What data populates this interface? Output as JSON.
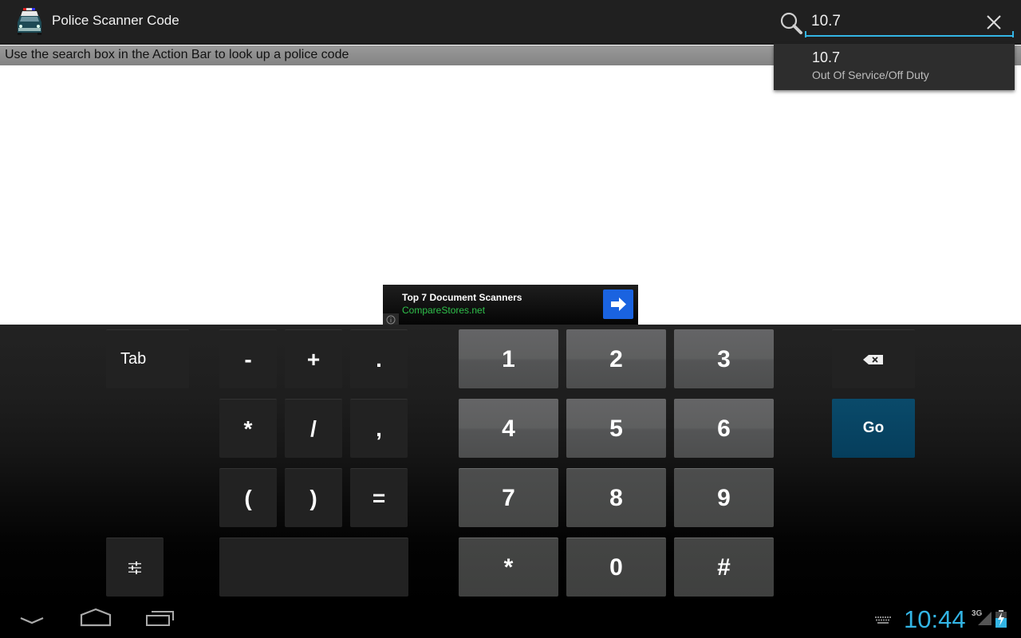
{
  "app": {
    "title": "Police Scanner Code",
    "icon": "police-car-icon"
  },
  "search": {
    "value": "10.7",
    "accent_color": "#33b5e5"
  },
  "hint": {
    "text": "Use the search box in the Action Bar to look up a police code"
  },
  "suggestions": [
    {
      "code": "10.7",
      "description": "Out Of Service/Off Duty"
    }
  ],
  "ad": {
    "title": "Top 7 Document Scanners",
    "url": "CompareStores.net",
    "info_icon": "info-icon",
    "arrow_icon": "arrow-right-icon",
    "url_color": "#2ec04a",
    "button_color": "#1a63e0"
  },
  "keyboard": {
    "tab_label": "Tab",
    "symbols": [
      "-",
      "+",
      ".",
      "*",
      "/",
      ",",
      "(",
      ")",
      "="
    ],
    "digits": [
      "1",
      "2",
      "3",
      "4",
      "5",
      "6",
      "7",
      "8",
      "9",
      "*",
      "0",
      "#"
    ],
    "go_label": "Go",
    "go_color": "#064563",
    "backspace_icon": "backspace-icon",
    "settings_icon": "settings-sliders-icon",
    "space_label": ""
  },
  "status": {
    "time": "10:44",
    "network": "3G",
    "keyboard_icon": "keyboard-icon",
    "signal_icon": "signal-icon",
    "battery_icon": "battery-charging-icon",
    "clock_color": "#33b5e5"
  },
  "nav": {
    "back_icon": "back-chevron-icon",
    "home_icon": "home-icon",
    "recents_icon": "recent-apps-icon"
  }
}
